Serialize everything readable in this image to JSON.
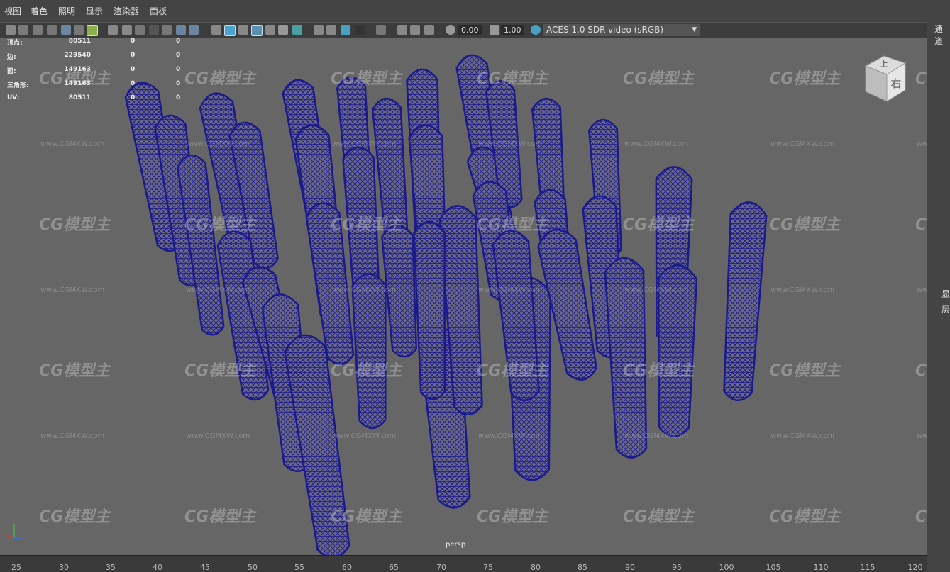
{
  "menu": [
    "视图",
    "着色",
    "照明",
    "显示",
    "渲染器",
    "面板"
  ],
  "toolbar": {
    "field_a": "0.00",
    "field_b": "1.00",
    "color_space": "ACES 1.0 SDR-video (sRGB)"
  },
  "hud": [
    {
      "label": "顶点:",
      "v1": "80511",
      "v2": "0",
      "v3": "0"
    },
    {
      "label": "边:",
      "v1": "229540",
      "v2": "0",
      "v3": "0"
    },
    {
      "label": "面:",
      "v1": "149163",
      "v2": "0",
      "v3": "0"
    },
    {
      "label": "三角形:",
      "v1": "149163",
      "v2": "0",
      "v3": "0"
    },
    {
      "label": "UV:",
      "v1": "80511",
      "v2": "0",
      "v3": "0"
    }
  ],
  "viewcube": {
    "top": "上",
    "right": "右"
  },
  "camera": "persp",
  "watermark": {
    "logo": "CG模型主",
    "url": "www.CGMXW.com"
  },
  "right_panel": {
    "channels": "通道",
    "display": "显",
    "layers": "层"
  },
  "ruler": [
    "25",
    "30",
    "35",
    "40",
    "45",
    "50",
    "55",
    "60",
    "65",
    "70",
    "75",
    "80",
    "85",
    "90",
    "95",
    "100",
    "105",
    "110",
    "115",
    "120"
  ],
  "colors": {
    "wire": "#1a1a8c",
    "viewport": "#666666"
  }
}
